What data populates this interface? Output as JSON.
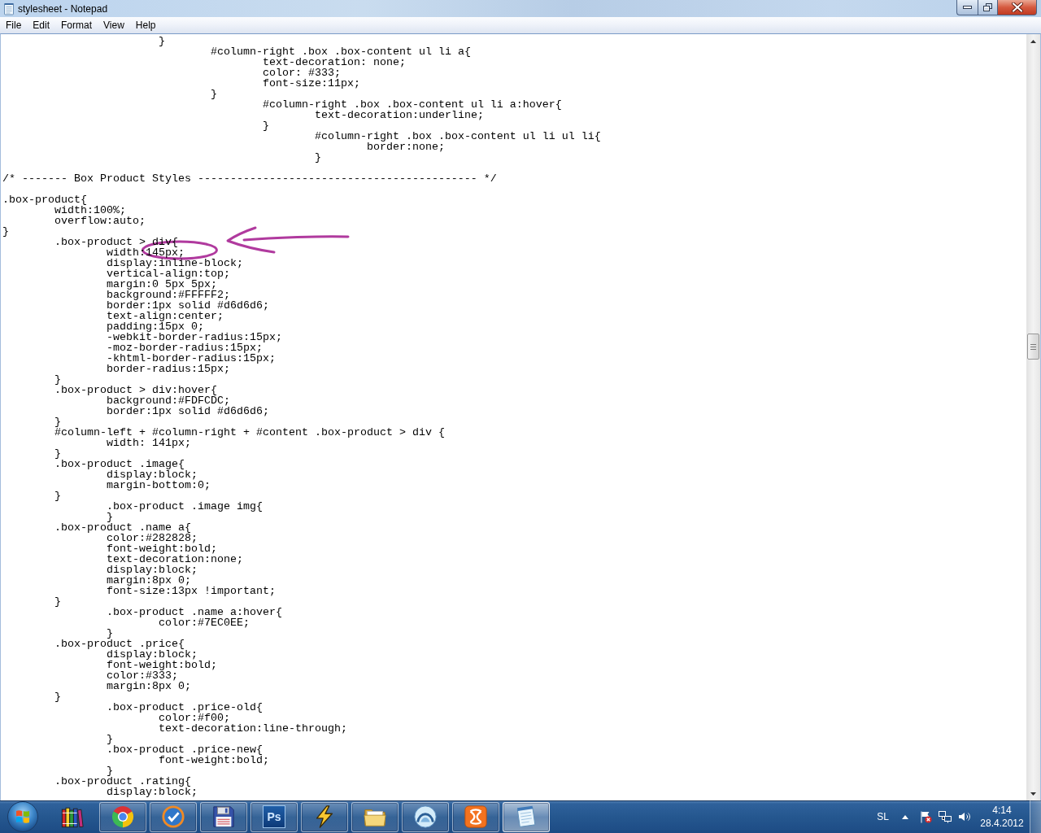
{
  "window": {
    "title": "stylesheet - Notepad"
  },
  "menu": [
    "File",
    "Edit",
    "Format",
    "View",
    "Help"
  ],
  "editor": {
    "blocks": [
      {
        "lines": [
          "\t\t\t}",
          "\t\t\t\t#column-right .box .box-content ul li a{",
          "\t\t\t\t\ttext-decoration: none;",
          "\t\t\t\t\tcolor: #333;",
          "\t\t\t\t\tfont-size:11px;",
          "\t\t\t\t}",
          "\t\t\t\t\t#column-right .box .box-content ul li a:hover{",
          "\t\t\t\t\t\ttext-decoration:underline;",
          "\t\t\t\t\t}",
          "\t\t\t\t\t\t#column-right .box .box-content ul li ul li{",
          "\t\t\t\t\t\t\tborder:none;",
          "\t\t\t\t\t\t}"
        ]
      },
      {
        "lines": [
          "/* ------- Box Product Styles ------------------------------------------- */"
        ]
      },
      {
        "lines": [
          ".box-product{",
          "\twidth:100%;",
          "\toverflow:auto;",
          "}",
          "\t.box-product > div{",
          "\t\twidth:145px;",
          "\t\tdisplay:inline-block;",
          "\t\tvertical-align:top;",
          "\t\tmargin:0 5px 5px;",
          "\t\tbackground:#FFFFF2;",
          "\t\tborder:1px solid #d6d6d6;",
          "\t\ttext-align:center;",
          "\t\tpadding:15px 0;",
          "\t\t-webkit-border-radius:15px;",
          "\t\t-moz-border-radius:15px;",
          "\t\t-khtml-border-radius:15px;",
          "\t\tborder-radius:15px;",
          "\t}",
          "\t.box-product > div:hover{",
          "\t\tbackground:#FDFCDC;",
          "\t\tborder:1px solid #d6d6d6;",
          "\t}",
          "\t#column-left + #column-right + #content .box-product > div {",
          "\t\twidth: 141px;",
          "\t}",
          "\t.box-product .image{",
          "\t\tdisplay:block;",
          "\t\tmargin-bottom:0;",
          "\t}",
          "\t\t.box-product .image img{",
          "\t\t}",
          "\t.box-product .name a{",
          "\t\tcolor:#282828;",
          "\t\tfont-weight:bold;",
          "\t\ttext-decoration:none;",
          "\t\tdisplay:block;",
          "\t\tmargin:8px 0;",
          "\t\tfont-size:13px !important;",
          "\t}",
          "\t\t.box-product .name a:hover{",
          "\t\t\tcolor:#7EC0EE;",
          "\t\t}",
          "\t.box-product .price{",
          "\t\tdisplay:block;",
          "\t\tfont-weight:bold;",
          "\t\tcolor:#333;",
          "\t\tmargin:8px 0;",
          "\t}",
          "\t\t.box-product .price-old{",
          "\t\t\tcolor:#f00;",
          "\t\t\ttext-decoration:line-through;",
          "\t\t}",
          "\t\t.box-product .price-new{",
          "\t\t\tfont-weight:bold;",
          "\t\t}",
          "\t.box-product .rating{",
          "\t\tdisplay:block;"
        ]
      }
    ]
  },
  "taskbar": {
    "buttons": [
      {
        "running": false,
        "selected": false
      },
      {
        "running": true,
        "selected": false
      },
      {
        "running": true,
        "selected": false
      },
      {
        "running": true,
        "selected": false
      },
      {
        "label": "Ps",
        "running": true,
        "selected": false
      },
      {
        "running": true,
        "selected": false
      },
      {
        "running": true,
        "selected": false
      },
      {
        "running": true,
        "selected": false
      },
      {
        "running": true,
        "selected": false
      },
      {
        "running": true,
        "selected": true
      }
    ],
    "tray": {
      "language": "SL",
      "time": "4:14",
      "date": "28.4.2012"
    }
  }
}
